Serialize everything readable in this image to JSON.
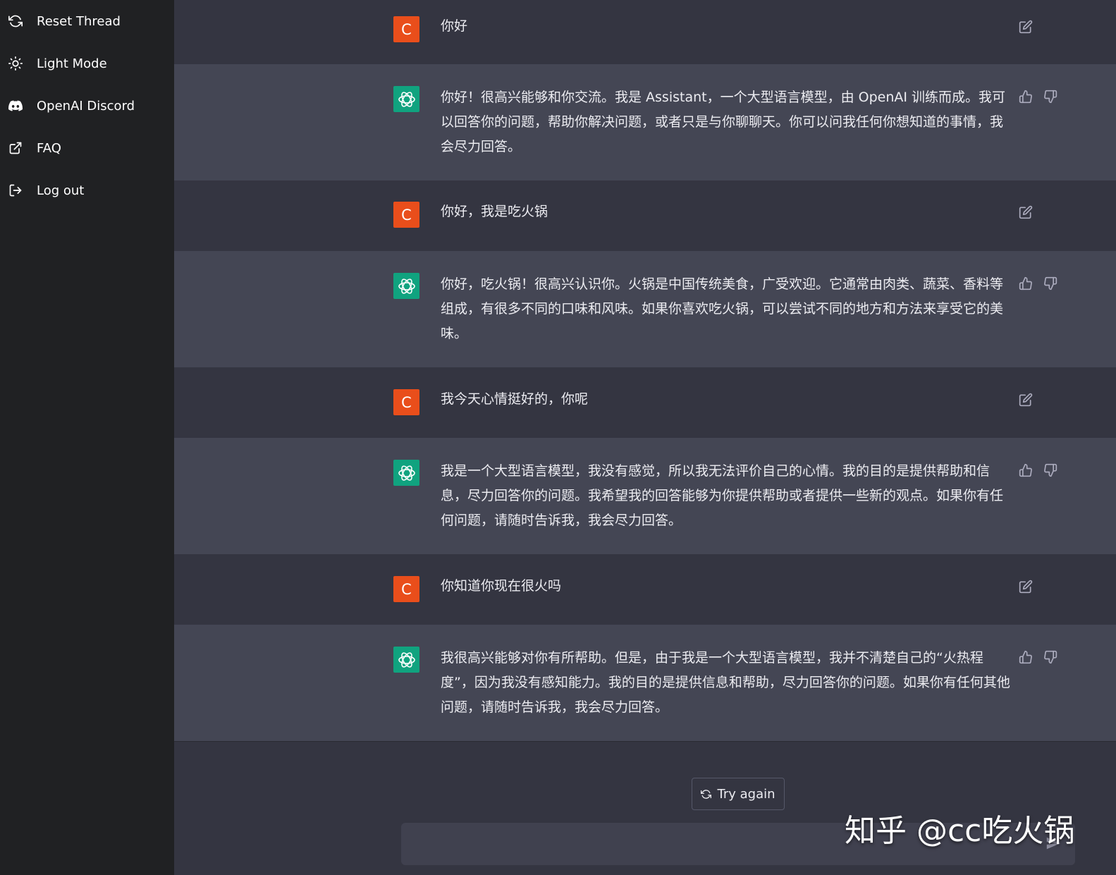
{
  "sidebar": {
    "items": [
      {
        "label": "Reset Thread",
        "icon": "refresh-icon"
      },
      {
        "label": "Light Mode",
        "icon": "sun-icon"
      },
      {
        "label": "OpenAI Discord",
        "icon": "discord-icon"
      },
      {
        "label": "FAQ",
        "icon": "external-link-icon"
      },
      {
        "label": "Log out",
        "icon": "logout-icon"
      }
    ]
  },
  "conversation": {
    "messages": [
      {
        "role": "user",
        "avatar": "C",
        "text": "你好"
      },
      {
        "role": "assistant",
        "text": "你好！很高兴能够和你交流。我是 Assistant，一个大型语言模型，由 OpenAI 训练而成。我可以回答你的问题，帮助你解决问题，或者只是与你聊聊天。你可以问我任何你想知道的事情，我会尽力回答。"
      },
      {
        "role": "user",
        "avatar": "C",
        "text": "你好，我是吃火锅"
      },
      {
        "role": "assistant",
        "text": "你好，吃火锅！很高兴认识你。火锅是中国传统美食，广受欢迎。它通常由肉类、蔬菜、香料等组成，有很多不同的口味和风味。如果你喜欢吃火锅，可以尝试不同的地方和方法来享受它的美味。"
      },
      {
        "role": "user",
        "avatar": "C",
        "text": "我今天心情挺好的，你呢"
      },
      {
        "role": "assistant",
        "text": "我是一个大型语言模型，我没有感觉，所以我无法评价自己的心情。我的目的是提供帮助和信息，尽力回答你的问题。我希望我的回答能够为你提供帮助或者提供一些新的观点。如果你有任何问题，请随时告诉我，我会尽力回答。"
      },
      {
        "role": "user",
        "avatar": "C",
        "text": "你知道你现在很火吗"
      },
      {
        "role": "assistant",
        "text": "我很高兴能够对你有所帮助。但是，由于我是一个大型语言模型，我并不清楚自己的“火热程度”，因为我没有感知能力。我的目的是提供信息和帮助，尽力回答你的问题。如果你有任何其他问题，请随时告诉我，我会尽力回答。"
      }
    ]
  },
  "try_again": {
    "label": "Try again"
  },
  "composer": {
    "placeholder": ""
  },
  "watermark": "知乎 @cc吃火锅",
  "colors": {
    "sidebar_bg": "#202123",
    "user_row_bg": "#343541",
    "assistant_row_bg": "#444654",
    "user_avatar": "#e94e1b",
    "assistant_avatar": "#10a37f"
  }
}
